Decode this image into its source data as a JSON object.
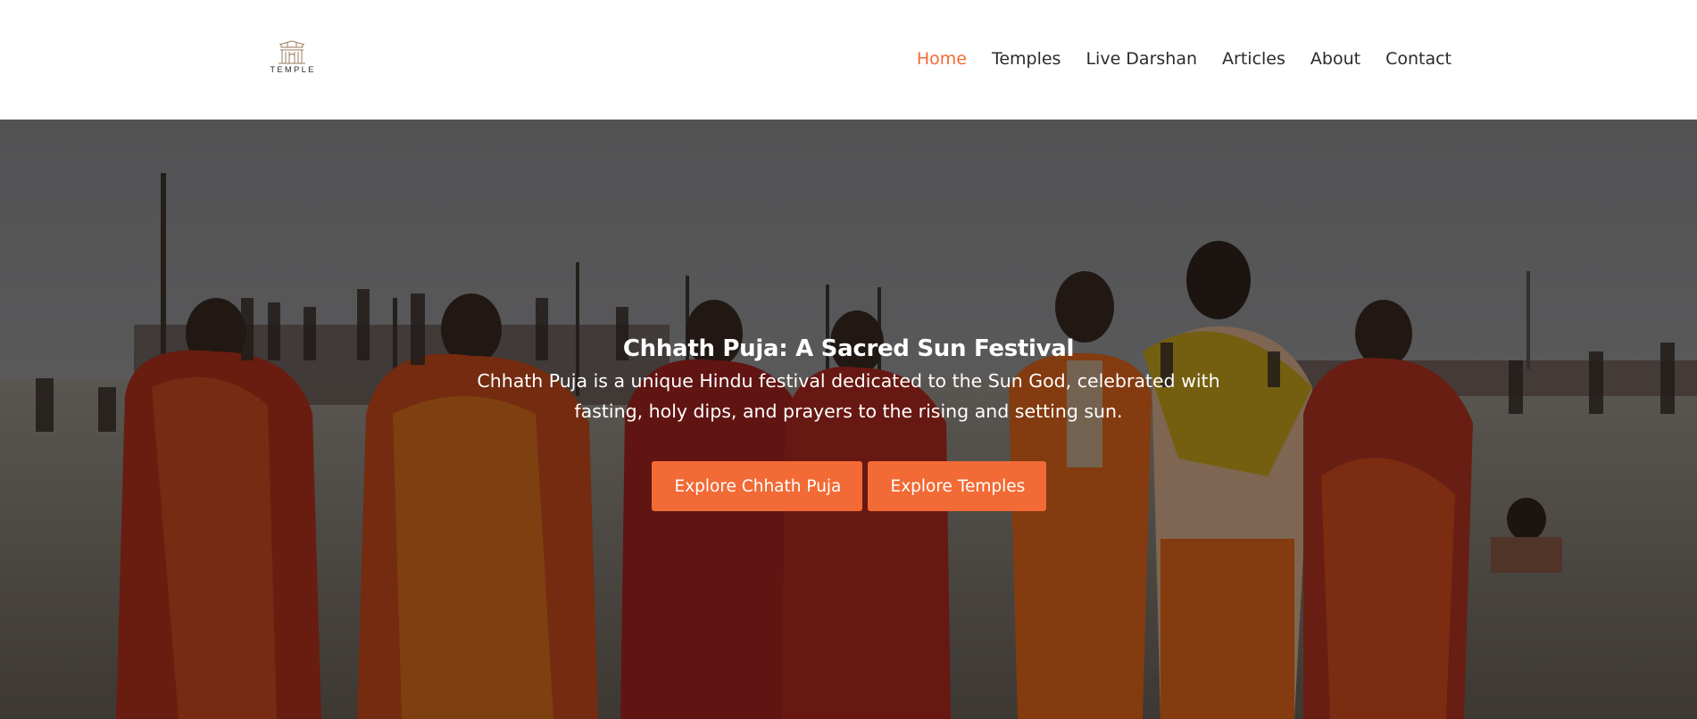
{
  "brand": {
    "logo_text": "TEMPLE"
  },
  "nav": {
    "items": [
      {
        "label": "Home",
        "active": true
      },
      {
        "label": "Temples"
      },
      {
        "label": "Live Darshan"
      },
      {
        "label": "Articles"
      },
      {
        "label": "About"
      },
      {
        "label": "Contact"
      }
    ]
  },
  "hero": {
    "title": "Chhath Puja: A Sacred Sun Festival",
    "description": "Chhath Puja is a unique Hindu festival dedicated to the Sun God, celebrated with fasting, holy dips, and prayers to the rising and setting sun.",
    "buttons": {
      "primary": "Explore Chhath Puja",
      "secondary": "Explore Temples"
    }
  },
  "colors": {
    "accent": "#f26a35",
    "nav_text": "#2b2b2b",
    "header_bg": "#ffffff"
  },
  "icons": [
    "temple-logo-icon"
  ]
}
